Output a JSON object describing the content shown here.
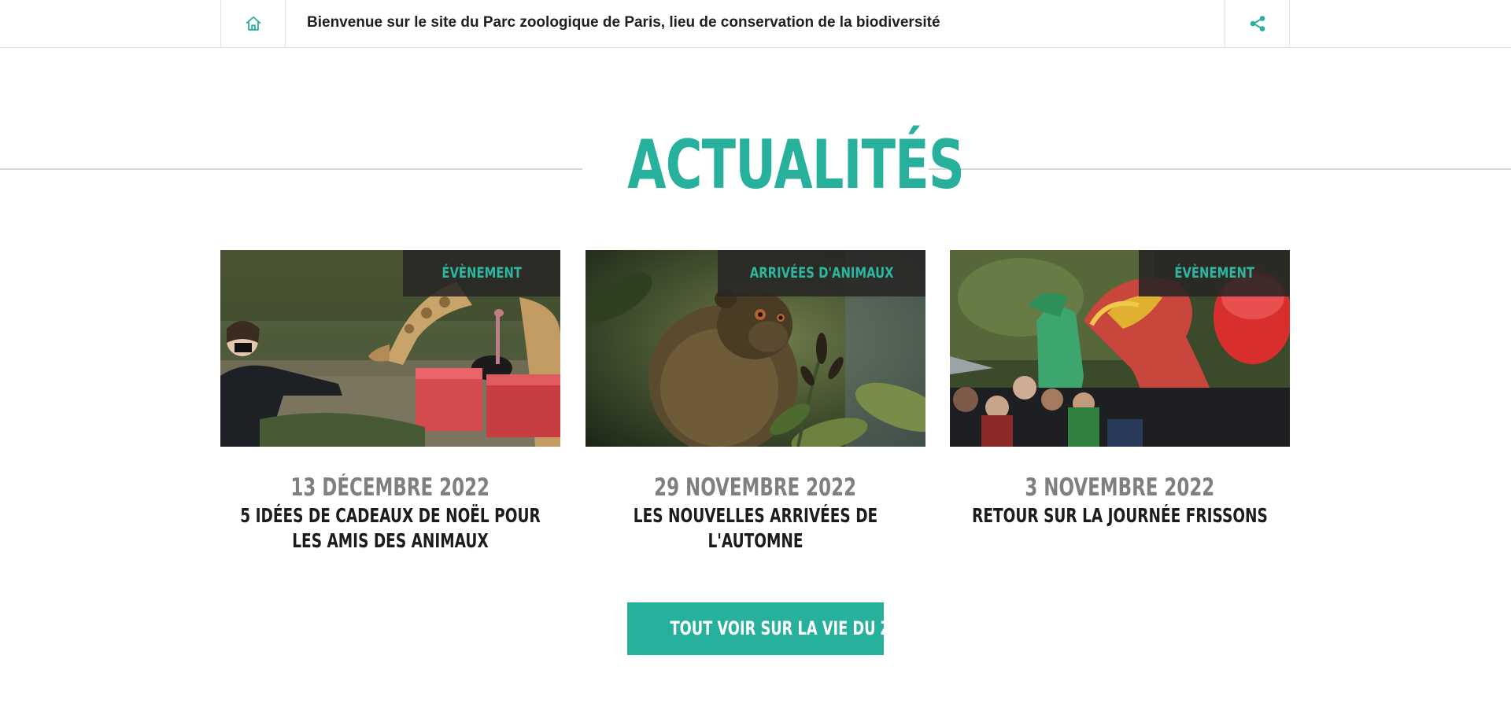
{
  "topbar": {
    "home_icon": "home-icon",
    "welcome_text": "Bienvenue sur le site du Parc zoologique de Paris, lieu de conservation de la biodiversité",
    "share_icon": "share-icon"
  },
  "news": {
    "section_title": "ACTUALITÉS",
    "cards": [
      {
        "tag": "ÉVÈNEMENT",
        "date": "13 DÉCEMBRE 2022",
        "headline": "5 IDÉES DE CADEAUX DE NOËL POUR LES AMIS DES ANIMAUX"
      },
      {
        "tag": "ARRIVÉES D'ANIMAUX",
        "date": "29 NOVEMBRE 2022",
        "headline": "LES NOUVELLES ARRIVÉES DE L'AUTOMNE"
      },
      {
        "tag": "ÉVÈNEMENT",
        "date": "3 NOVEMBRE 2022",
        "headline": "RETOUR SUR LA JOURNÉE FRISSONS"
      }
    ],
    "cta_label": "TOUT VOIR SUR LA VIE DU ZOO"
  },
  "colors": {
    "accent": "#27b09b",
    "tag_background": "#282624",
    "date_gray": "#7f7f7f",
    "headline_dark": "#1c1c1c"
  }
}
